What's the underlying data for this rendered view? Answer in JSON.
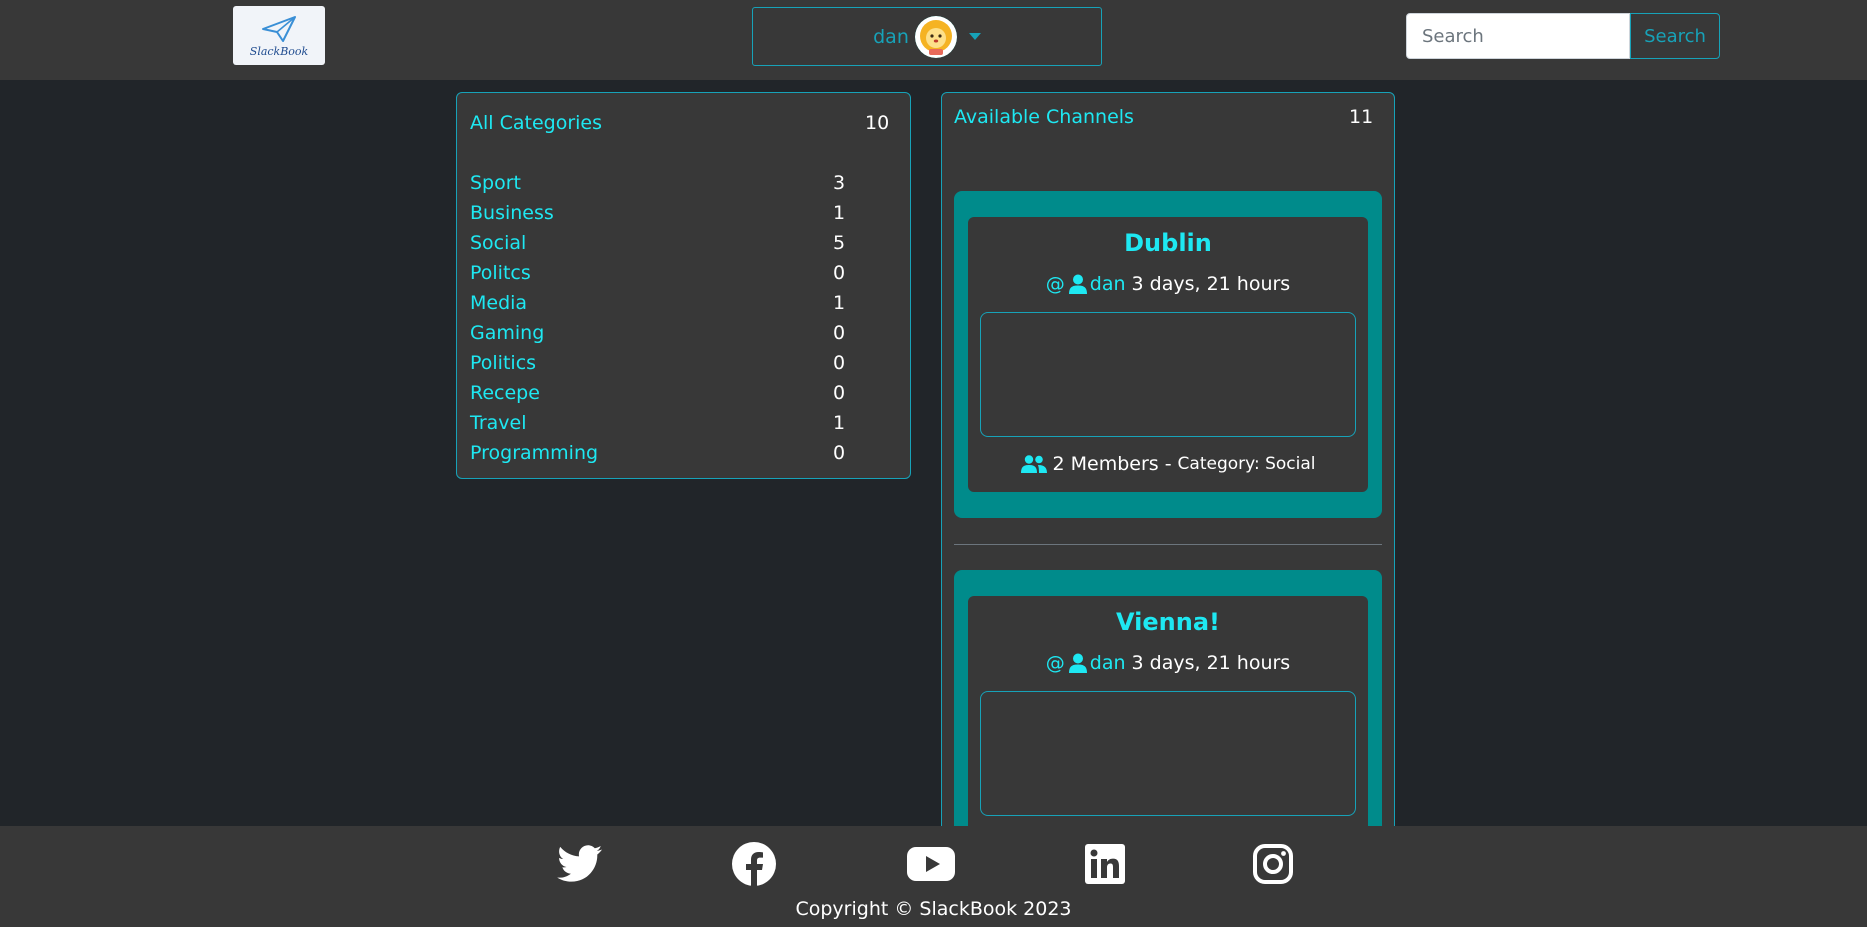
{
  "header": {
    "logo_text": "SlackBook",
    "user_name": "dan",
    "search_placeholder": "Search",
    "search_button": "Search"
  },
  "categories": {
    "title": "All Categories",
    "total": "10",
    "items": [
      {
        "label": "Sport",
        "count": "3"
      },
      {
        "label": "Business",
        "count": "1"
      },
      {
        "label": "Social",
        "count": "5"
      },
      {
        "label": "Politcs",
        "count": "0"
      },
      {
        "label": "Media",
        "count": "1"
      },
      {
        "label": "Gaming",
        "count": "0"
      },
      {
        "label": "Politics",
        "count": "0"
      },
      {
        "label": "Recepe",
        "count": "0"
      },
      {
        "label": "Travel",
        "count": "1"
      },
      {
        "label": "Programming",
        "count": "0"
      }
    ]
  },
  "channels": {
    "title": "Available Channels",
    "count": "11",
    "items": [
      {
        "name": "Dublin",
        "at": "@",
        "owner": "dan",
        "age": "3 days, 21 hours",
        "members": "2 Members",
        "separator": "-",
        "category": "Category: Social"
      },
      {
        "name": "Vienna!",
        "at": "@",
        "owner": "dan",
        "age": "3 days, 21 hours"
      }
    ]
  },
  "footer": {
    "copyright": "Copyright © SlackBook 2023",
    "social_icons": [
      "twitter-icon",
      "facebook-icon",
      "youtube-icon",
      "linkedin-icon",
      "instagram-icon"
    ]
  },
  "colors": {
    "background": "#212529",
    "panel": "#383838",
    "accent": "#17a2b8",
    "link": "#1ee8f2",
    "card": "#008b8b"
  }
}
